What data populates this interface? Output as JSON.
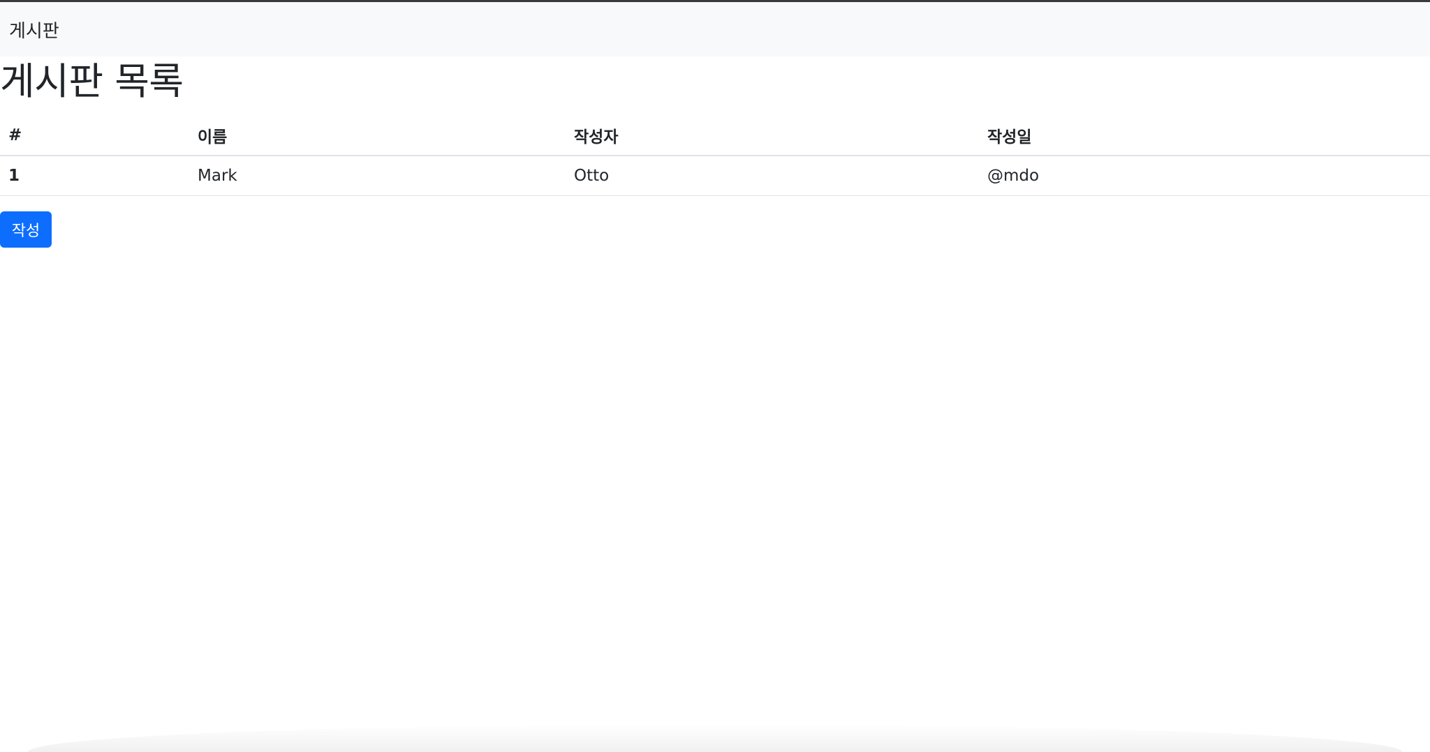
{
  "navbar": {
    "brand": "게시판"
  },
  "main": {
    "title": "게시판 목록",
    "table": {
      "headers": [
        "#",
        "이름",
        "작성자",
        "작성일"
      ],
      "rows": [
        [
          "1",
          "Mark",
          "Otto",
          "@mdo"
        ]
      ]
    },
    "write_button_label": "작성"
  },
  "colors": {
    "primary": "#0d6efd",
    "navbar_bg": "#f8f9fa",
    "text": "#212529"
  }
}
